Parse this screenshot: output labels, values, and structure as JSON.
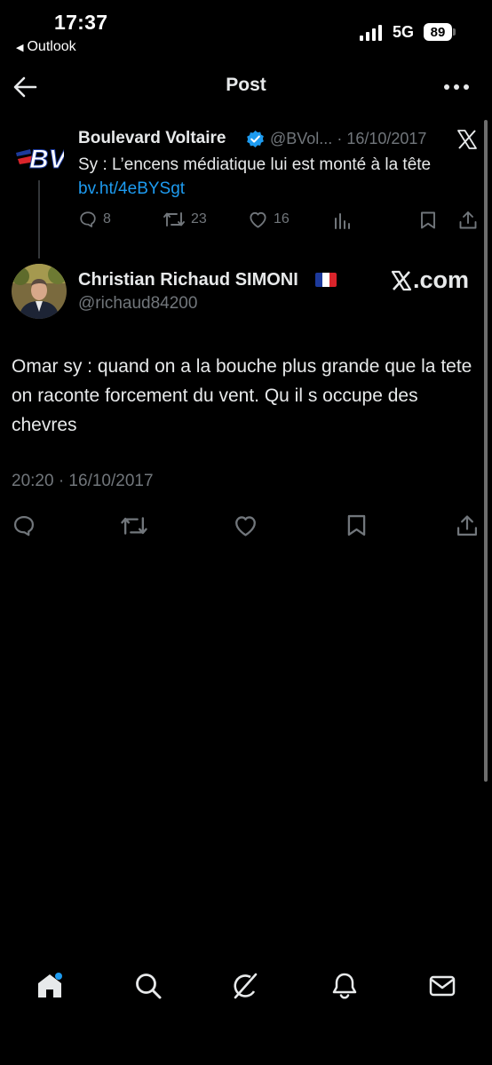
{
  "status_bar": {
    "time": "17:37",
    "back_app": "Outlook",
    "network": "5G",
    "battery": "89"
  },
  "header": {
    "title": "Post"
  },
  "quoted_post": {
    "author_name": "Boulevard Voltaire",
    "handle": "@BVol...",
    "date": "· 16/10/2017",
    "text": "Sy : L’encens médiatique lui est monté à la tête",
    "link": "bv.ht/4eBYSgt",
    "replies": "8",
    "reposts": "23",
    "likes": "16",
    "logo_text": "BV"
  },
  "main_post": {
    "author_name": "Christian Richaud SIMONI",
    "handle": "@richaud84200",
    "text": "Omar sy : quand on a la bouche plus grande que la tete on raconte forcement du vent. Qu il s occupe des chevres",
    "timestamp": "20:20 · 16/10/2017",
    "source_badge": ".com"
  },
  "colors": {
    "background": "#000000",
    "text": "#e7e9ea",
    "muted": "#71767b",
    "accent": "#1d9bf0"
  },
  "bottom_nav": [
    "home-icon",
    "search-icon",
    "grok-icon",
    "notifications-icon",
    "messages-icon"
  ]
}
